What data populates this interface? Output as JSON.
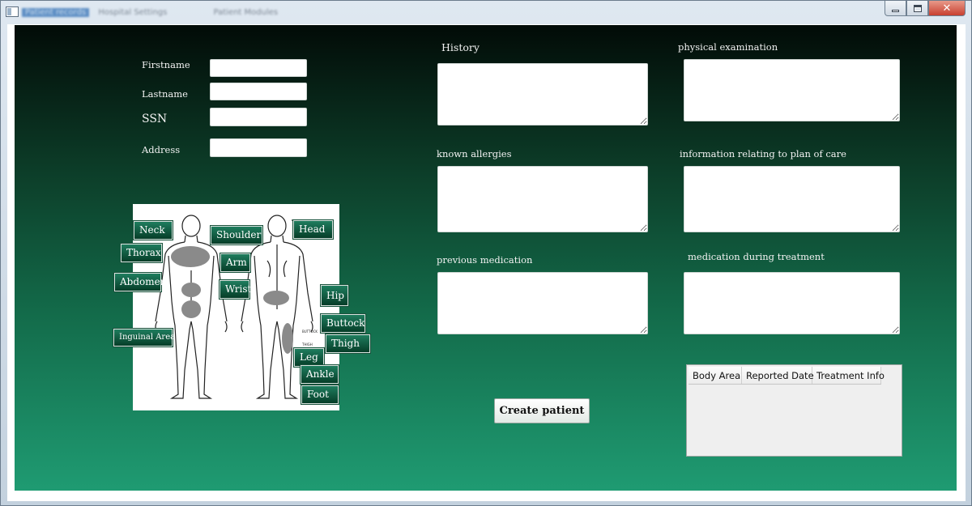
{
  "window": {
    "blurred_tabs": [
      "Patient records",
      "Hospital Settings",
      "Patient Modules"
    ],
    "controls": {
      "close_glyph": "✕"
    }
  },
  "form": {
    "firstname_label": "Firstname",
    "lastname_label": "Lastname",
    "ssn_label": "SSN",
    "address_label": "Address",
    "firstname_value": "",
    "lastname_value": "",
    "ssn_value": "",
    "address_value": ""
  },
  "sections": {
    "history": "History",
    "physical_examination": "physical examination",
    "known_allergies": "known allergies",
    "plan_of_care": "information relating to plan of care",
    "previous_medication": "previous medication",
    "medication_during_treatment": "medication during treatment"
  },
  "body_map": {
    "front_tags": [
      "Neck",
      "Thorax",
      "Abdomen",
      "Inguinal Area",
      "Shoulder",
      "Arm",
      "Wrist"
    ],
    "back_tags": [
      "Head",
      "Hip",
      "Buttock",
      "Thigh",
      "Leg",
      "Ankle",
      "Foot"
    ],
    "figure_notes": [
      "BUTTOCK",
      "THIGH"
    ],
    "highlight_color": "#8a8a8a"
  },
  "actions": {
    "create_patient": "Create patient"
  },
  "table": {
    "columns": [
      "Body Area",
      "Reported Date",
      "Treatment Info"
    ],
    "rows": []
  },
  "colors": {
    "gradient_top": "#020b07",
    "gradient_bottom": "#1f9b72",
    "tag_fill": "#0f5a3f"
  }
}
